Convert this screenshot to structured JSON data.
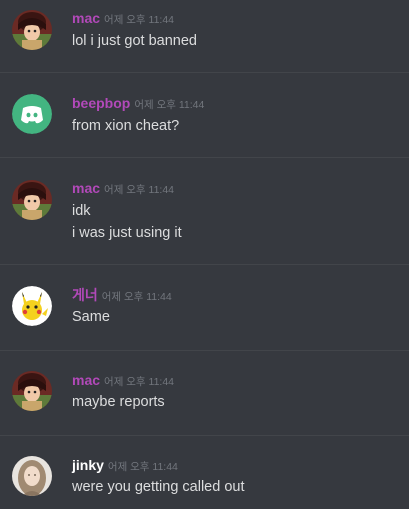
{
  "colors": {
    "background": "#36393f",
    "mac": "#b249b9",
    "beepbop": "#b249b9",
    "gamer": "#b249b9",
    "jinky": "#ffffff",
    "timestamp": "#72767d",
    "text": "#dcddde"
  },
  "messages": [
    {
      "username": "mac",
      "timestamp": "어제 오후 11:44",
      "avatar_icon": "anime-character-avatar-icon",
      "lines": [
        "lol i just got banned"
      ]
    },
    {
      "username": "beepbop",
      "timestamp": "어제 오후 11:44",
      "avatar_icon": "discord-logo-avatar-icon",
      "lines": [
        "from xion cheat?"
      ]
    },
    {
      "username": "mac",
      "timestamp": "어제 오후 11:44",
      "avatar_icon": "anime-character-avatar-icon",
      "lines": [
        "idk",
        "i was just using it"
      ]
    },
    {
      "username": "게너",
      "timestamp": "어제 오후 11:44",
      "avatar_icon": "pikachu-avatar-icon",
      "lines": [
        "Same"
      ]
    },
    {
      "username": "mac",
      "timestamp": "어제 오후 11:44",
      "avatar_icon": "anime-character-avatar-icon",
      "lines": [
        "maybe reports"
      ]
    },
    {
      "username": "jinky",
      "timestamp": "어제 오후 11:44",
      "avatar_icon": "person-photo-avatar-icon",
      "lines": [
        "were you getting called out"
      ]
    }
  ]
}
